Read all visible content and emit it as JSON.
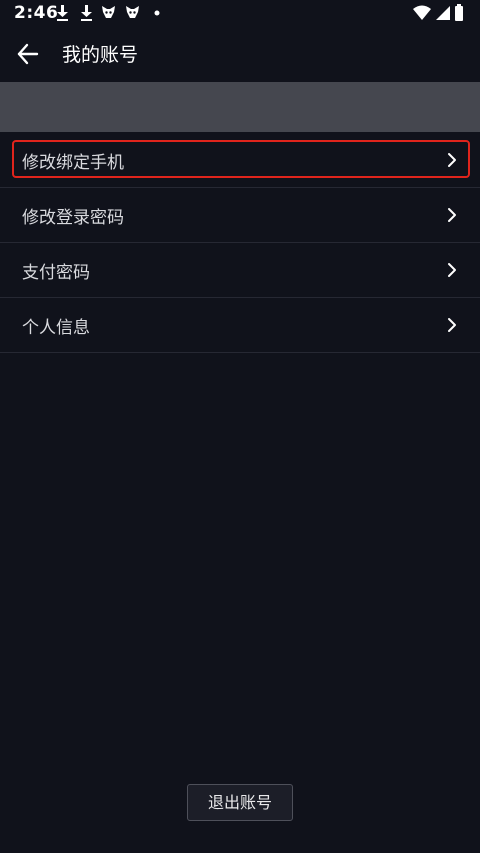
{
  "status_bar": {
    "time": "2:46"
  },
  "header": {
    "title": "我的账号",
    "back_icon": "arrow-left-icon"
  },
  "menu": {
    "items": [
      {
        "label": "修改绑定手机",
        "highlighted": true
      },
      {
        "label": "修改登录密码"
      },
      {
        "label": "支付密码"
      },
      {
        "label": "个人信息"
      }
    ]
  },
  "footer": {
    "logout_label": "退出账号"
  },
  "colors": {
    "background": "#10121b",
    "banner": "#45474f",
    "highlight_border": "#e0241c",
    "divider": "#262833"
  }
}
